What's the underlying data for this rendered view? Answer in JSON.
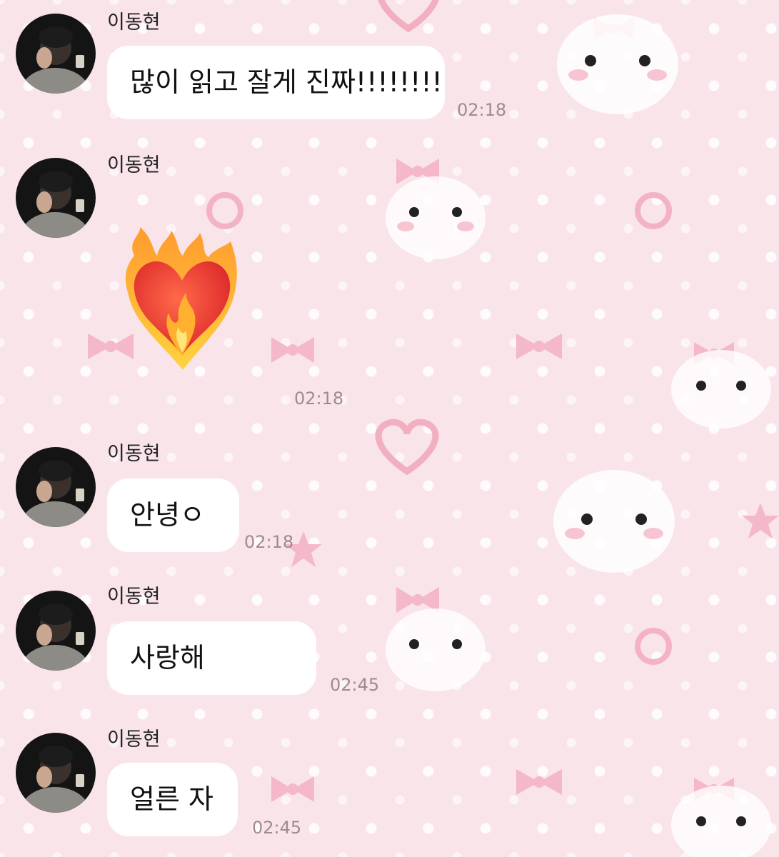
{
  "chat": {
    "messages": [
      {
        "sender": "이동현",
        "type": "text",
        "text": "많이 읽고 잘게 진짜!!!!!!!!",
        "time": "02:18"
      },
      {
        "sender": "이동현",
        "type": "emoji",
        "emoji": "heart-on-fire-icon",
        "time": "02:18"
      },
      {
        "sender": "이동현",
        "type": "text",
        "text": "안녕ㅇ",
        "time": "02:18"
      },
      {
        "sender": "이동현",
        "type": "text",
        "text": "사랑해",
        "time": "02:45"
      },
      {
        "sender": "이동현",
        "type": "text",
        "text": "얼른 자",
        "time": "02:45"
      }
    ]
  },
  "theme": {
    "background": "#f9e4ea",
    "bubble": "#ffffff",
    "timestamp": "#a08a8f",
    "decor_pink": "#f2b6c6"
  }
}
